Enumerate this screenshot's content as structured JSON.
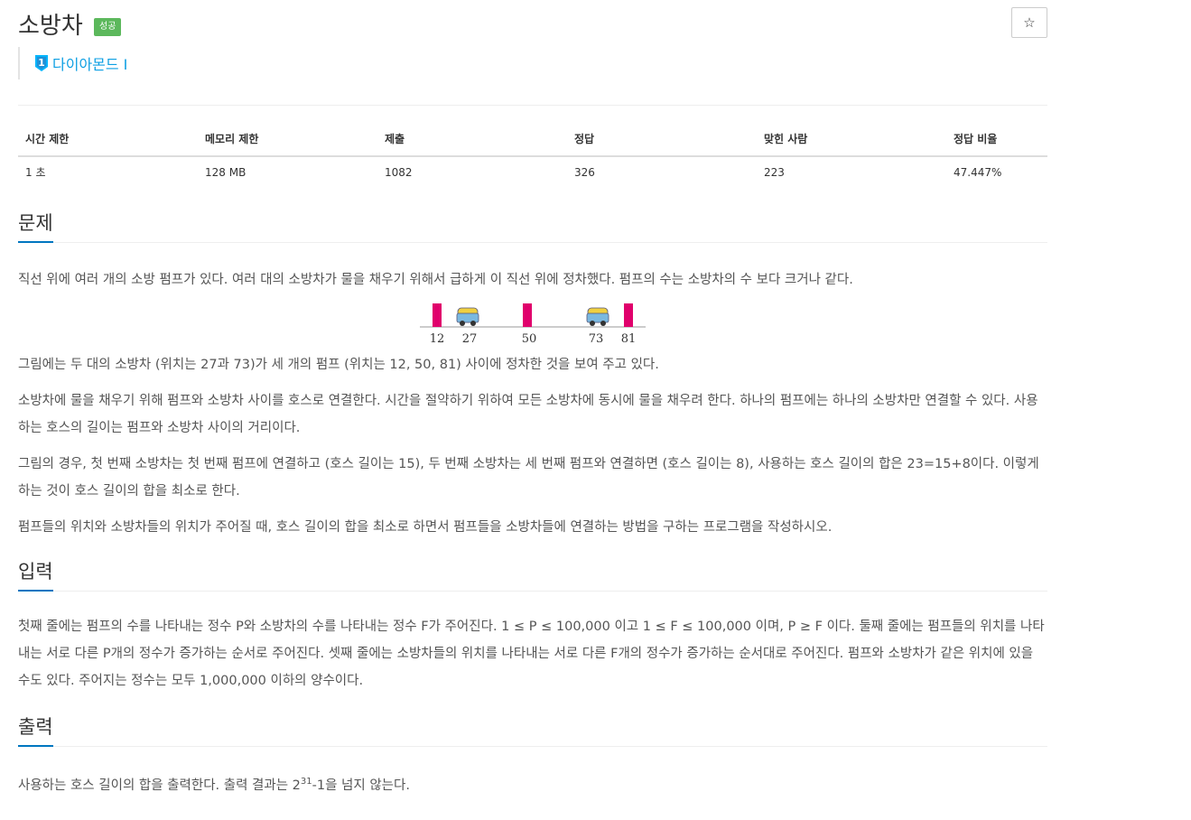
{
  "problem": {
    "title": "소방차",
    "badge": "성공",
    "star": "☆",
    "tier_number": "1",
    "tier_label": "다이아몬드 I"
  },
  "info_table": {
    "headers": [
      "시간 제한",
      "메모리 제한",
      "제출",
      "정답",
      "맞힌 사람",
      "정답 비율"
    ],
    "values": [
      "1 초",
      "128 MB",
      "1082",
      "326",
      "223",
      "47.447%"
    ]
  },
  "sections": {
    "problem_title": "문제",
    "problem_p1": "직선 위에 여러 개의 소방 펌프가 있다. 여러 대의 소방차가 물을 채우기 위해서 급하게 이 직선 위에 정차했다. 펌프의 수는 소방차의 수 보다 크거나 같다.",
    "problem_p2": "그림에는 두 대의 소방차 (위치는 27과 73)가 세 개의 펌프 (위치는 12, 50, 81) 사이에 정차한 것을 보여 주고 있다.",
    "problem_p3": "소방차에 물을 채우기 위해 펌프와 소방차 사이를 호스로 연결한다. 시간을 절약하기 위하여 모든 소방차에 동시에 물을 채우려 한다. 하나의 펌프에는 하나의 소방차만 연결할 수 있다. 사용하는 호스의 길이는 펌프와 소방차 사이의 거리이다.",
    "problem_p4": "그림의 경우, 첫 번째 소방차는 첫 번째 펌프에 연결하고 (호스 길이는 15), 두 번째 소방차는 세 번째 펌프와 연결하면 (호스 길이는 8), 사용하는 호스 길이의 합은 23=15+8이다. 이렇게 하는 것이 호스 길이의 합을 최소로 한다.",
    "problem_p5": "펌프들의 위치와 소방차들의 위치가 주어질 때, 호스 길이의 합을 최소로 하면서 펌프들을 소방차들에 연결하는 방법을 구하는 프로그램을 작성하시오.",
    "input_title": "입력",
    "input_p1": "첫째 줄에는 펌프의 수를 나타내는 정수 P와 소방차의 수를 나타내는 정수 F가 주어진다. 1 ≤ P ≤ 100,000 이고 1 ≤ F ≤ 100,000 이며, P ≥ F 이다. 둘째 줄에는 펌프들의 위치를 나타내는 서로 다른 P개의 정수가 증가하는 순서로 주어진다. 셋째 줄에는 소방차들의 위치를 나타내는 서로 다른 F개의 정수가 증가하는 순서대로 주어진다. 펌프와 소방차가 같은 위치에 있을 수도 있다. 주어지는 정수는 모두 1,000,000 이하의 양수이다.",
    "output_title": "출력",
    "output_pre": "사용하는 호스 길이의 합을 출력한다. 출력 결과는 2",
    "output_sup": "31",
    "output_post": "-1을 넘지 않는다."
  },
  "figure": {
    "labels": [
      "12",
      "27",
      "50",
      "73",
      "81"
    ],
    "pump_color": "#e0006c",
    "truck_color": "#7ab8e0"
  }
}
